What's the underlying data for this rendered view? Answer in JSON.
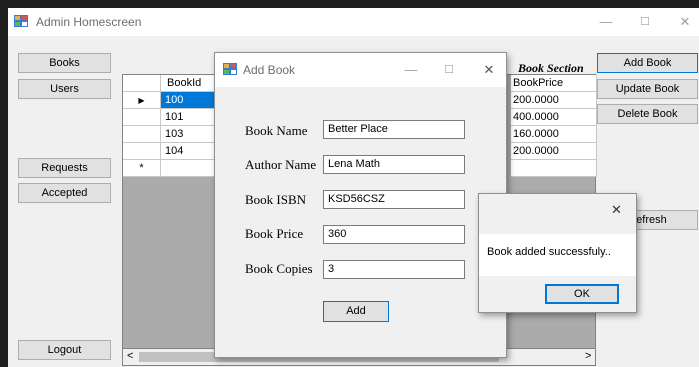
{
  "window": {
    "title": "Admin Homescreen",
    "minimize": "—",
    "maximize": "☐",
    "close": "✕"
  },
  "left_nav": {
    "books": "Books",
    "users": "Users",
    "requests": "Requests",
    "accepted": "Accepted",
    "logout": "Logout"
  },
  "right_actions": {
    "section_title": "Book Section",
    "add_book": "Add Book",
    "update_book": "Update Book",
    "delete_book": "Delete Book",
    "refresh": "Refresh"
  },
  "table": {
    "columns": [
      "BookId",
      "BookPrice"
    ],
    "rows": [
      {
        "id": "100",
        "price": "200.0000"
      },
      {
        "id": "101",
        "price": "400.0000"
      },
      {
        "id": "103",
        "price": "160.0000"
      },
      {
        "id": "104",
        "price": "200.0000"
      }
    ],
    "current_row_marker": "▶",
    "new_row_marker": "*",
    "scroll_left": "<",
    "scroll_right": ">"
  },
  "add_book_dialog": {
    "title": "Add Book",
    "minimize": "—",
    "maximize": "☐",
    "close": "✕",
    "labels": {
      "name": "Book Name",
      "author": "Author Name",
      "isbn": "Book ISBN",
      "price": "Book Price",
      "copies": "Book Copies"
    },
    "values": {
      "name": "Better Place",
      "author": "Lena Math",
      "isbn": "KSD56CSZ",
      "price": "360",
      "copies": "3"
    },
    "add_button": "Add"
  },
  "message_box": {
    "close": "✕",
    "text": "Book added successfuly..",
    "ok": "OK"
  },
  "colors": {
    "selection": "#0078d7",
    "grid_background": "#ababab"
  }
}
